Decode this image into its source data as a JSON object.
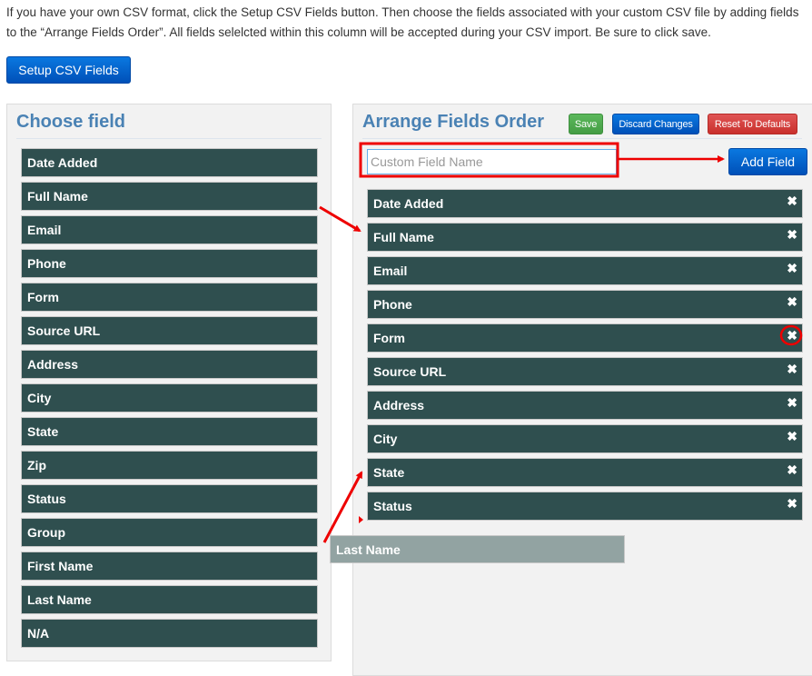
{
  "intro_text": "If you have your own CSV format, click the Setup CSV Fields button. Then choose the fields associated with your custom CSV file by adding fields to the “Arrange Fields Order”. All fields selelcted within this column will be accepted during your CSV import. Be sure to click save.",
  "setup_button_label": "Setup CSV Fields",
  "choose_panel": {
    "title": "Choose field",
    "fields": [
      "Date Added",
      "Full Name",
      "Email",
      "Phone",
      "Form",
      "Source URL",
      "Address",
      "City",
      "State",
      "Zip",
      "Status",
      "Group",
      "First Name",
      "Last Name",
      "N/A"
    ]
  },
  "arrange_panel": {
    "title": "Arrange Fields Order",
    "save_label": "Save",
    "discard_label": "Discard Changes",
    "reset_label": "Reset To Defaults",
    "custom_field_input": {
      "value": "",
      "placeholder": "Custom Field Name"
    },
    "add_field_label": "Add Field",
    "remove_icon": "✖",
    "fields": [
      "Date Added",
      "Full Name",
      "Email",
      "Phone",
      "Form",
      "Source URL",
      "Address",
      "City",
      "State",
      "Status"
    ]
  },
  "dragging_item": {
    "label": "Last Name"
  },
  "colors": {
    "field_bg": "#2f4f4f",
    "title": "#4a82b4",
    "annotation": "#ee0000",
    "save": "#5cb85c",
    "primary": "#0a6ad6",
    "danger": "#d9534f"
  }
}
